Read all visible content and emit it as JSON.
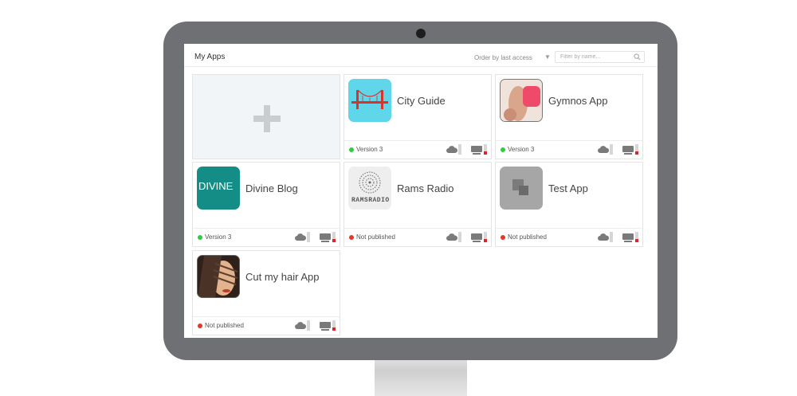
{
  "header": {
    "title": "My Apps",
    "order_by": "Order by last access",
    "filter_placeholder": "Filter by name..."
  },
  "colors": {
    "monitor": "#6f7074",
    "published": "#2ecc40",
    "not_published": "#e2382a",
    "indicator_red": "#e0232b"
  },
  "icons": {
    "add": "plus-icon",
    "search": "search-icon",
    "cloud": "cloud-icon",
    "device": "device-icon"
  },
  "apps": [
    {
      "name": "City Guide",
      "status": "Version 3",
      "published": true,
      "icon": "bridge-icon"
    },
    {
      "name": "Gymnos App",
      "status": "Version 3",
      "published": true,
      "icon": "fitness-photo-icon"
    },
    {
      "name": "Divine Blog",
      "status": "Version 3",
      "published": true,
      "icon": "divine-logo-icon",
      "icon_text": "DIVINE"
    },
    {
      "name": "Rams Radio",
      "status": "Not published",
      "published": false,
      "icon": "rams-radio-logo-icon",
      "icon_text": "RAMSRADIO"
    },
    {
      "name": "Test App",
      "status": "Not published",
      "published": false,
      "icon": "placeholder-square-icon"
    },
    {
      "name": "Cut my hair App",
      "status": "Not published",
      "published": false,
      "icon": "hair-photo-icon"
    }
  ]
}
